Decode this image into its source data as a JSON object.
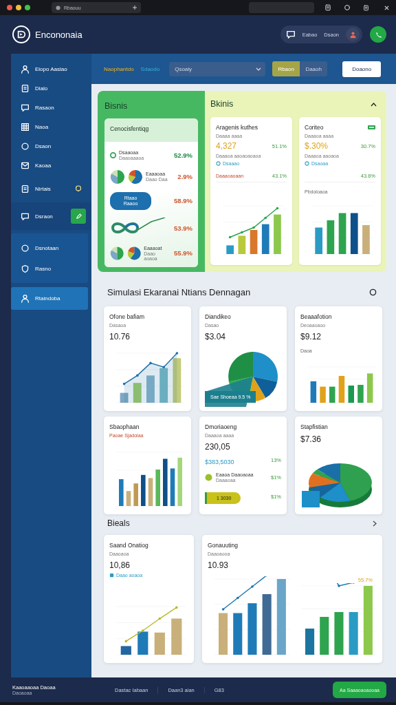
{
  "browser": {
    "tab_title": "Rbaouu"
  },
  "header": {
    "app_title": "Encononaia",
    "links": [
      "Eabao",
      "Dsaon"
    ]
  },
  "sidebar": {
    "items": [
      {
        "label": "Eiopo Aasiao",
        "kind": "link",
        "selected": false
      },
      {
        "label": "Dialo",
        "kind": "link",
        "selected": false
      },
      {
        "label": "Rasaon",
        "kind": "link",
        "selected": false
      },
      {
        "label": "Naoa",
        "kind": "link",
        "selected": false
      },
      {
        "label": "Dsaon",
        "kind": "link",
        "selected": false
      },
      {
        "label": "Kaoaa",
        "kind": "link",
        "selected": false
      },
      {
        "label": "Nirtais",
        "kind": "link",
        "selected": true
      },
      {
        "label": "Dsraon",
        "kind": "action",
        "selected": false
      },
      {
        "label": "Dsnotaan",
        "kind": "group",
        "selected": false
      },
      {
        "label": "Rasno",
        "kind": "group",
        "selected": false
      },
      {
        "label": "Rtaindoba",
        "kind": "accent",
        "selected": false
      }
    ]
  },
  "toolbar": {
    "tabs": [
      {
        "label": "Naophantdo",
        "selected": true
      },
      {
        "label": "Sdaodo",
        "selected": false
      }
    ],
    "select": {
      "value": "Qsoaly"
    },
    "segments": [
      {
        "label": "Rbaon",
        "selected": true
      },
      {
        "label": "Daaoh",
        "selected": false
      }
    ],
    "button": "Doaono"
  },
  "top_panel": {
    "left_title": "Bisnis",
    "right_title": "Bkinis",
    "summary_card": {
      "title": "Cenocisfentiqg",
      "rows": [
        {
          "kind": "dot",
          "label": "Dsaaoaa",
          "sub": "Daaoaaaoa",
          "value": "52.9%",
          "color": "#1e8a45"
        },
        {
          "kind": "pies",
          "label": "Eaaaoaa",
          "sub": "Daao Daa",
          "value": "2.9%",
          "color": "#d2542a"
        },
        {
          "kind": "pill",
          "label": "Rtaao Raaoo",
          "value": "58.9%",
          "color": "#d2542a"
        },
        {
          "kind": "loop",
          "value": "53.9%",
          "color": "#d2542a"
        },
        {
          "kind": "pies",
          "label": "Eaaaoat",
          "sub": "Daao aoaoa",
          "value": "55.9%",
          "color": "#d2542a"
        }
      ]
    },
    "metric_cards": [
      {
        "title": "Aragenis kuthes",
        "badge": false,
        "subtitle": "Daaaa aaaa",
        "value": "4,327",
        "change": "51.1%",
        "note": "Daaaoa aaoaoaoaoa",
        "link": "Dsaaao",
        "section": "Daaaoaoaan",
        "section_change": "43.1%",
        "kind": "bars-line"
      },
      {
        "title": "Coriteo",
        "badge": true,
        "subtitle": "Daaaoa aaaa",
        "value": "$.30%",
        "change": "30.7%",
        "note": "Daaaoa aaoaoa",
        "link": "Dsaoaa",
        "section_change": "43.6%",
        "chart_title": "Pbdoloaoa",
        "kind": "bars"
      }
    ]
  },
  "simulation": {
    "title": "Simulasi Ekaranai Ntians Dennagan",
    "rows": [
      {
        "cards": [
          {
            "kind": "bars-line",
            "title": "Ofone bafiam",
            "subtitle": "Dasaoa",
            "value": "10.76"
          },
          {
            "kind": "pie",
            "title": "Diandikeo",
            "subtitle": "Dasao",
            "value": "$3.04",
            "chart_label": "Sae Shoeaa 9.5 %"
          },
          {
            "kind": "bars",
            "title": "Beaaafotion",
            "subtitle": "Deoaaoaoo",
            "value": "$9.12",
            "chart_label": "Daoa"
          }
        ]
      },
      {
        "cards": [
          {
            "kind": "bars",
            "title": "Sbaophaan",
            "section": "Paoae Sjadoiaa"
          },
          {
            "kind": "list",
            "title": "Dmoriaoeng",
            "subtitle": "Daaaoa aaaa",
            "value": "230,05",
            "highlight": "$383,5030",
            "highlight_change": "13%",
            "item_label": "Eaaoa Daaoaoaa",
            "item_sub": "Daaaoaa",
            "item_change": "$1%",
            "pill": "1 3030",
            "pill_change": "$1%"
          },
          {
            "kind": "pie3d",
            "title": "Stapfistian",
            "value": "$7.36"
          }
        ]
      }
    ]
  },
  "reports": {
    "title": "Bieals",
    "cards": [
      {
        "kind": "bars-line",
        "title": "Saand Onatiog",
        "subtitle": "Daaoaoa",
        "value": "10,86",
        "legend": "Daao aoaoa"
      },
      {
        "kind": "dual",
        "title": "Gonauuting",
        "subtitle": "Daaoaooa",
        "value": "10.93",
        "change": "55.7%"
      }
    ]
  },
  "footer": {
    "title": "Kaaoaaoaa Daoaa",
    "subtitle": "Daoaoaa",
    "links": [
      "Dastac Iabaan",
      "Daan3 aian",
      "G83"
    ],
    "button": "Aa Saaaoaoaooaa"
  }
}
